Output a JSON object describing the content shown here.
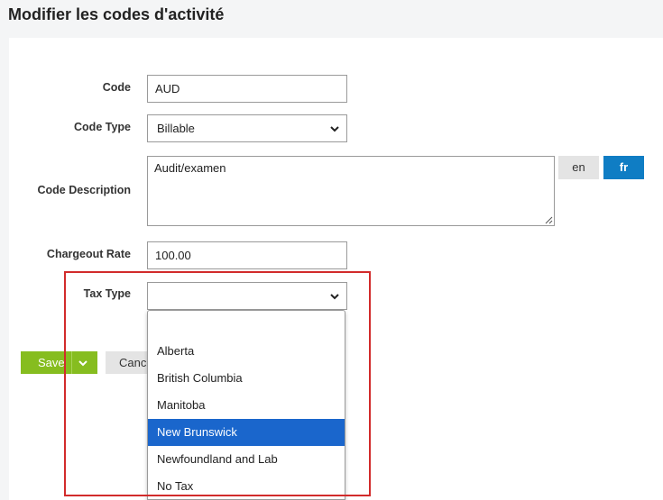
{
  "page": {
    "title": "Modifier les codes d'activité"
  },
  "form": {
    "code": {
      "label": "Code",
      "value": "AUD"
    },
    "code_type": {
      "label": "Code Type",
      "value": "Billable"
    },
    "code_description": {
      "label": "Code Description",
      "value": "Audit/examen"
    },
    "language": {
      "en_label": "en",
      "fr_label": "fr",
      "active": "fr"
    },
    "chargeout_rate": {
      "label": "Chargeout Rate",
      "value": "100.00"
    },
    "tax_type": {
      "label": "Tax Type",
      "value": "",
      "options": [
        "",
        "Alberta",
        "British Columbia",
        "Manitoba",
        "New Brunswick",
        "Newfoundland and Lab",
        "No Tax"
      ],
      "highlighted": "New Brunswick"
    }
  },
  "actions": {
    "save_label": "Save",
    "cancel_label": "Cancel"
  },
  "colors": {
    "save": "#86bd1f",
    "lang_active": "#0f7dc4",
    "highlight": "#1a66cc",
    "annotation": "#d22b2b"
  }
}
